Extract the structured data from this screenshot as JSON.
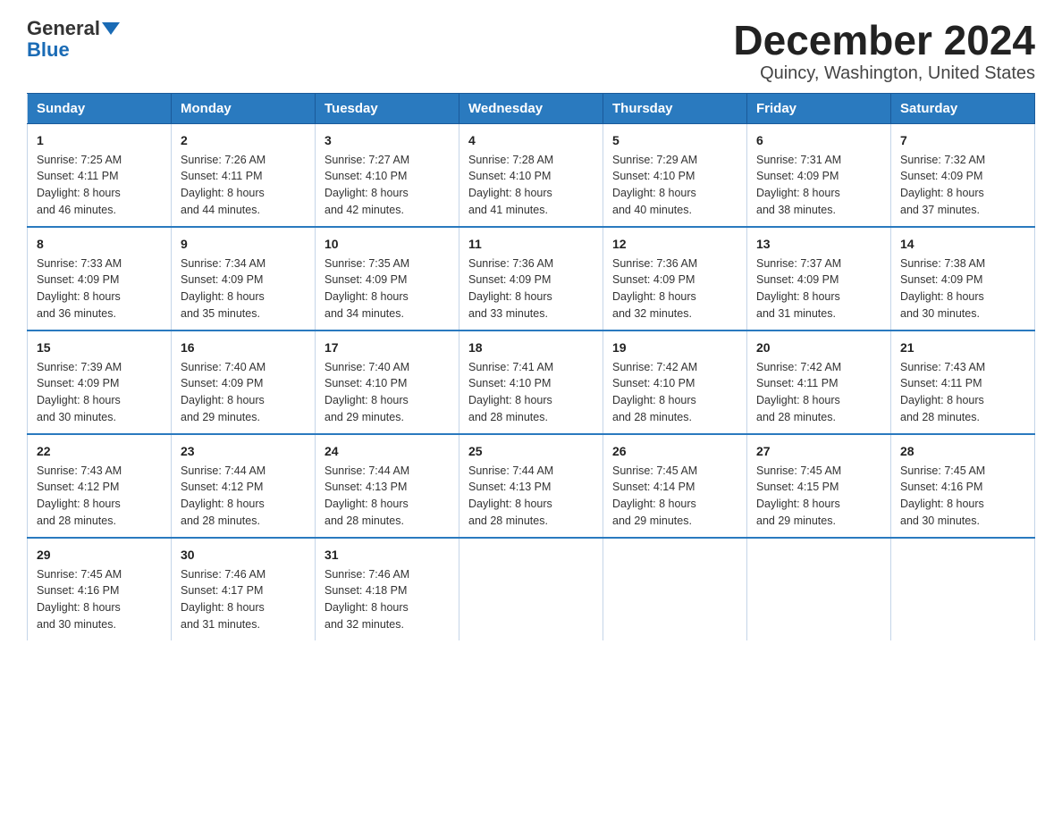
{
  "header": {
    "logo_general": "General",
    "logo_blue": "Blue",
    "title": "December 2024",
    "subtitle": "Quincy, Washington, United States"
  },
  "days_of_week": [
    "Sunday",
    "Monday",
    "Tuesday",
    "Wednesday",
    "Thursday",
    "Friday",
    "Saturday"
  ],
  "weeks": [
    [
      {
        "day": "1",
        "sunrise": "7:25 AM",
        "sunset": "4:11 PM",
        "daylight": "8 hours and 46 minutes."
      },
      {
        "day": "2",
        "sunrise": "7:26 AM",
        "sunset": "4:11 PM",
        "daylight": "8 hours and 44 minutes."
      },
      {
        "day": "3",
        "sunrise": "7:27 AM",
        "sunset": "4:10 PM",
        "daylight": "8 hours and 42 minutes."
      },
      {
        "day": "4",
        "sunrise": "7:28 AM",
        "sunset": "4:10 PM",
        "daylight": "8 hours and 41 minutes."
      },
      {
        "day": "5",
        "sunrise": "7:29 AM",
        "sunset": "4:10 PM",
        "daylight": "8 hours and 40 minutes."
      },
      {
        "day": "6",
        "sunrise": "7:31 AM",
        "sunset": "4:09 PM",
        "daylight": "8 hours and 38 minutes."
      },
      {
        "day": "7",
        "sunrise": "7:32 AM",
        "sunset": "4:09 PM",
        "daylight": "8 hours and 37 minutes."
      }
    ],
    [
      {
        "day": "8",
        "sunrise": "7:33 AM",
        "sunset": "4:09 PM",
        "daylight": "8 hours and 36 minutes."
      },
      {
        "day": "9",
        "sunrise": "7:34 AM",
        "sunset": "4:09 PM",
        "daylight": "8 hours and 35 minutes."
      },
      {
        "day": "10",
        "sunrise": "7:35 AM",
        "sunset": "4:09 PM",
        "daylight": "8 hours and 34 minutes."
      },
      {
        "day": "11",
        "sunrise": "7:36 AM",
        "sunset": "4:09 PM",
        "daylight": "8 hours and 33 minutes."
      },
      {
        "day": "12",
        "sunrise": "7:36 AM",
        "sunset": "4:09 PM",
        "daylight": "8 hours and 32 minutes."
      },
      {
        "day": "13",
        "sunrise": "7:37 AM",
        "sunset": "4:09 PM",
        "daylight": "8 hours and 31 minutes."
      },
      {
        "day": "14",
        "sunrise": "7:38 AM",
        "sunset": "4:09 PM",
        "daylight": "8 hours and 30 minutes."
      }
    ],
    [
      {
        "day": "15",
        "sunrise": "7:39 AM",
        "sunset": "4:09 PM",
        "daylight": "8 hours and 30 minutes."
      },
      {
        "day": "16",
        "sunrise": "7:40 AM",
        "sunset": "4:09 PM",
        "daylight": "8 hours and 29 minutes."
      },
      {
        "day": "17",
        "sunrise": "7:40 AM",
        "sunset": "4:10 PM",
        "daylight": "8 hours and 29 minutes."
      },
      {
        "day": "18",
        "sunrise": "7:41 AM",
        "sunset": "4:10 PM",
        "daylight": "8 hours and 28 minutes."
      },
      {
        "day": "19",
        "sunrise": "7:42 AM",
        "sunset": "4:10 PM",
        "daylight": "8 hours and 28 minutes."
      },
      {
        "day": "20",
        "sunrise": "7:42 AM",
        "sunset": "4:11 PM",
        "daylight": "8 hours and 28 minutes."
      },
      {
        "day": "21",
        "sunrise": "7:43 AM",
        "sunset": "4:11 PM",
        "daylight": "8 hours and 28 minutes."
      }
    ],
    [
      {
        "day": "22",
        "sunrise": "7:43 AM",
        "sunset": "4:12 PM",
        "daylight": "8 hours and 28 minutes."
      },
      {
        "day": "23",
        "sunrise": "7:44 AM",
        "sunset": "4:12 PM",
        "daylight": "8 hours and 28 minutes."
      },
      {
        "day": "24",
        "sunrise": "7:44 AM",
        "sunset": "4:13 PM",
        "daylight": "8 hours and 28 minutes."
      },
      {
        "day": "25",
        "sunrise": "7:44 AM",
        "sunset": "4:13 PM",
        "daylight": "8 hours and 28 minutes."
      },
      {
        "day": "26",
        "sunrise": "7:45 AM",
        "sunset": "4:14 PM",
        "daylight": "8 hours and 29 minutes."
      },
      {
        "day": "27",
        "sunrise": "7:45 AM",
        "sunset": "4:15 PM",
        "daylight": "8 hours and 29 minutes."
      },
      {
        "day": "28",
        "sunrise": "7:45 AM",
        "sunset": "4:16 PM",
        "daylight": "8 hours and 30 minutes."
      }
    ],
    [
      {
        "day": "29",
        "sunrise": "7:45 AM",
        "sunset": "4:16 PM",
        "daylight": "8 hours and 30 minutes."
      },
      {
        "day": "30",
        "sunrise": "7:46 AM",
        "sunset": "4:17 PM",
        "daylight": "8 hours and 31 minutes."
      },
      {
        "day": "31",
        "sunrise": "7:46 AM",
        "sunset": "4:18 PM",
        "daylight": "8 hours and 32 minutes."
      },
      null,
      null,
      null,
      null
    ]
  ],
  "labels": {
    "sunrise": "Sunrise:",
    "sunset": "Sunset:",
    "daylight": "Daylight:"
  }
}
